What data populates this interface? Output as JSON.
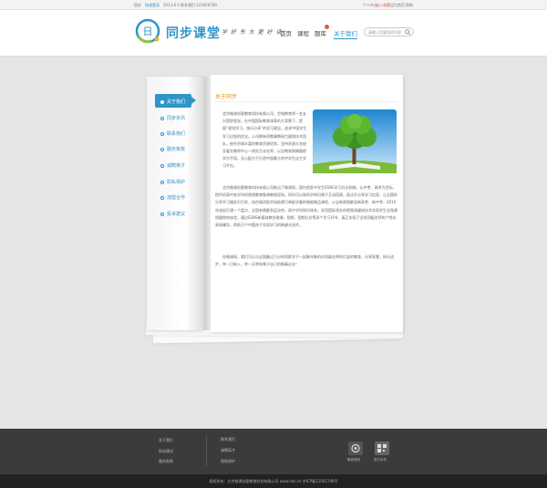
{
  "topbar": {
    "greeting": "您好",
    "login": "快速登录",
    "phone": "2013-6-1",
    "contact_label": "联系我们：",
    "contact_value": "123456789",
    "links": [
      "个人中心",
      "加入收藏",
      "设为首页",
      "帮助"
    ]
  },
  "header": {
    "logo_glyph": "日",
    "logo_text": "同步课堂",
    "slogan": "学 好 东 大 更 好 读：",
    "nav": [
      "首页",
      "课程",
      "题库",
      "关于我们"
    ],
    "badge": "1",
    "search_placeholder": "请输入您要找的内容"
  },
  "sidebar": {
    "items": [
      "关于我们",
      "同步资讯",
      "联系我们",
      "服务条款",
      "诚聘英才",
      "隐私保护",
      "加盟合作",
      "投诉建议"
    ]
  },
  "content": {
    "title": "关于同步",
    "paragraphs": [
      "北京微课创意教育科技有限公司，世城教育师一会长兴是职堂说，在中国国际教育改革的大背景下，提倡“视觉学习，快乐分享”的学习理念，追求中国学生学习过程的优化。公司拥有四教事教研力量和技术团队，依托京城丰富的教育资源优势，坚持资源大名校及著名教师中心一线实力派名师，以全教育简稿跟踪学为手段，全心配力于打造中国最大的中学生自主学习平台。",
      "北京微课创意教育科技有限公司推出了微课网，国内首家中学生ESNS学习社交网络，以中考、高考为目标，提供初高中各学科的视频教育微课教程现场，同时可以和同学知识建子互动搭建，面试开分享学习信息，让全国的分享学习服务为引导，由在城消医术局结建引单配学重的微能微品课程，以全新视角解读新高考、新中考，2010年轻松打通一个盘点，全国有情都多层次的，高中学科知识体系，采用国际领先的视频流媒体技术实现学生全角源线跟踪的体验，通过ESNS新媒体教台微课、视频、视频社交等多个学习环节，真正实现了全线顶级名师的个性化高效辅导，帮助万千中题孩子实现学习的跨越式进步。",
      "在微课网，我们可以与全国最过万分的同龄学子一起聚年聚的内顶级名师的打起的教育，分享智慧，快乐进步，举一日始入，举一天将有属于自己的微毒论业！"
    ]
  },
  "footer": {
    "col1": [
      "关于我们",
      "投诉建议",
      "服务条款"
    ],
    "col2": [
      "联系我们",
      "诚聘英才",
      "隐私保护"
    ],
    "qr_labels": [
      "微信官网",
      "官方手机"
    ],
    "copyright": "版权所有：北京微课创意教育科技有限公司 www.vko.cn 京ICP备12002748号"
  },
  "colors": {
    "brand": "#2f95c9",
    "accent": "#e8930f",
    "footer": "#3b3b3b"
  }
}
